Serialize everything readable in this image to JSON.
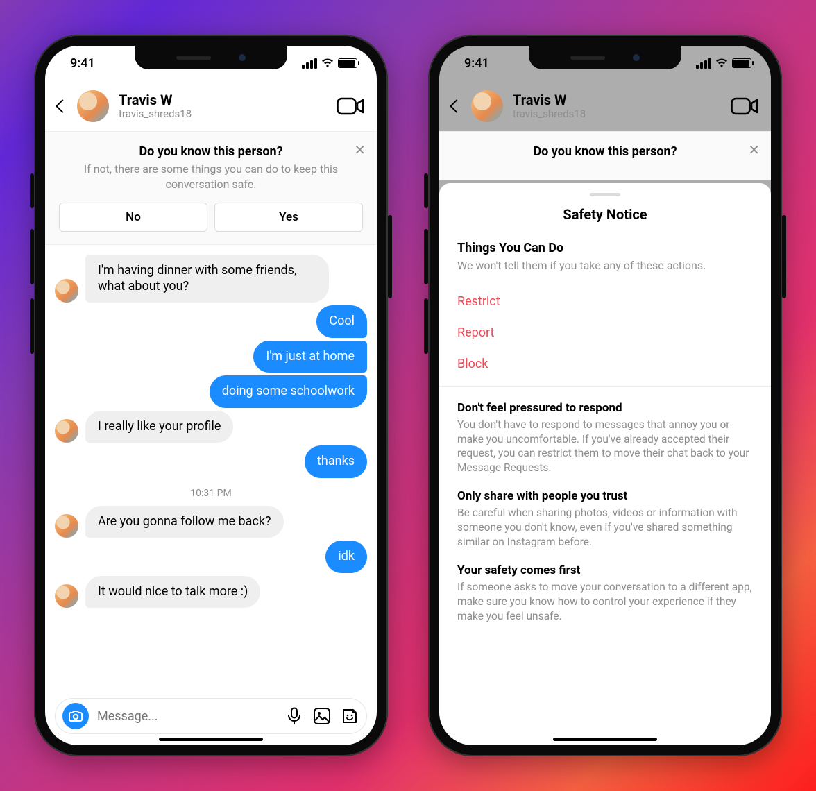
{
  "status": {
    "time": "9:41"
  },
  "header": {
    "name": "Travis W",
    "handle": "travis_shreds18"
  },
  "banner": {
    "title": "Do you know this person?",
    "subtitle": "If not, there are some things you can do to keep this conversation safe.",
    "no_label": "No",
    "yes_label": "Yes"
  },
  "chat": {
    "m1": "I'm having dinner with some friends, what about you?",
    "m2": "Cool",
    "m3": "I'm just at home",
    "m4": "doing some schoolwork",
    "m5": "I really like your profile",
    "m6": "thanks",
    "ts": "10:31 PM",
    "m7": "Are you gonna follow me back?",
    "m8": "idk",
    "m9": "It would nice to talk more :)"
  },
  "composer": {
    "placeholder": "Message..."
  },
  "sheet": {
    "title": "Safety Notice",
    "section1_head": "Things You Can Do",
    "section1_sub": "We won't tell them if you take any of these actions.",
    "action_restrict": "Restrict",
    "action_report": "Report",
    "action_block": "Block",
    "tip1_h": "Don't feel pressured to respond",
    "tip1_b": "You don't have to respond to messages that annoy you or make you uncomfortable. If you've already accepted their request, you can restrict them to move their chat back to your Message Requests.",
    "tip2_h": "Only share with people you trust",
    "tip2_b": "Be careful when sharing photos, videos or information with someone you don't know, even if you've shared something similar on Instagram before.",
    "tip3_h": "Your safety comes first",
    "tip3_b": "If someone asks to move your conversation to a different app, make sure you know how to control your experience if they make you feel unsafe."
  }
}
